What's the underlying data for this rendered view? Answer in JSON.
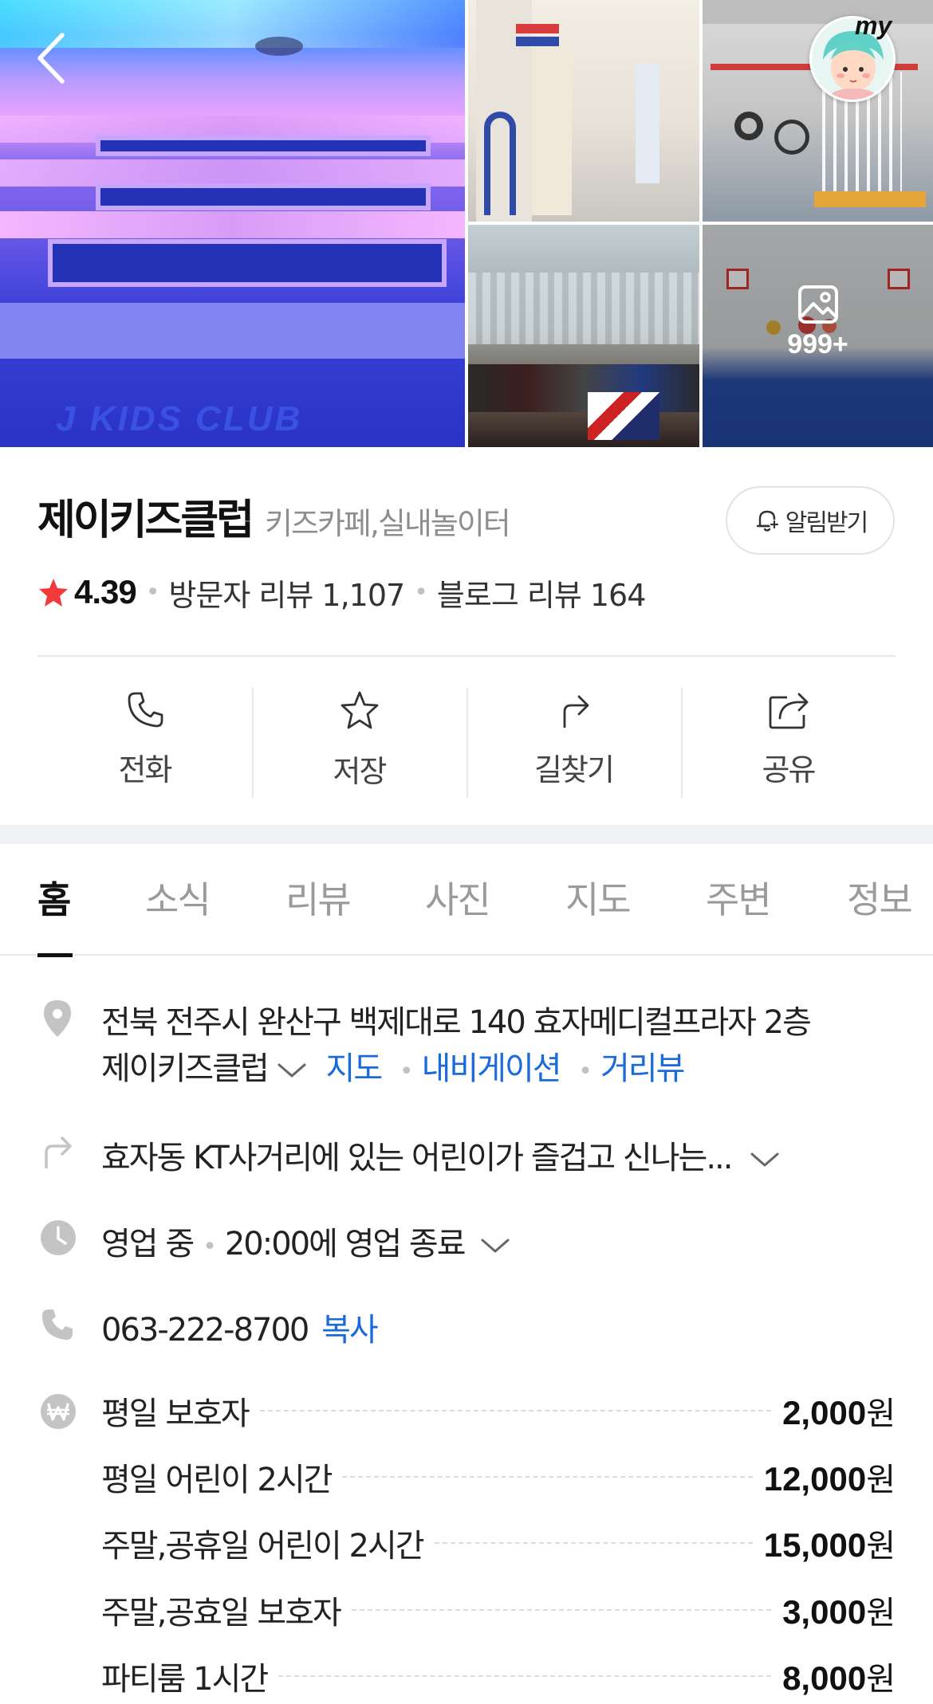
{
  "gallery": {
    "more_count": "999+",
    "main_photo_text": "J KIDS CLUB"
  },
  "nav": {
    "my_label": "my"
  },
  "place": {
    "name": "제이키즈클럽",
    "category": "키즈카페,실내놀이터",
    "alarm_label": "알림받기",
    "rating": "4.39",
    "visitor_reviews": "방문자 리뷰 1,107",
    "blog_reviews": "블로그 리뷰 164",
    "star_color": "#f23a3a"
  },
  "actions": [
    {
      "label": "전화",
      "icon": "phone-icon"
    },
    {
      "label": "저장",
      "icon": "star-icon"
    },
    {
      "label": "길찾기",
      "icon": "directions-icon"
    },
    {
      "label": "공유",
      "icon": "share-icon"
    }
  ],
  "tabs": [
    "홈",
    "소식",
    "리뷰",
    "사진",
    "지도",
    "주변",
    "정보"
  ],
  "info": {
    "address_line1": "전북 전주시 완산구 백제대로 140 효자메디컬프라자 2층",
    "address_line2": "제이키즈클럽",
    "map_link": "지도",
    "navigation_link": "내비게이션",
    "streetview_link": "거리뷰",
    "directions_text": "효자동 KT사거리에 있는 어린이가 즐겁고 신나는...",
    "status": "영업 중",
    "close_time": "20:00에 영업 종료",
    "phone": "063-222-8700",
    "copy_label": "복사",
    "link_color": "#1a6ad9"
  },
  "prices": [
    {
      "name": "평일 보호자",
      "value": "2,000",
      "unit": "원"
    },
    {
      "name": "평일 어린이 2시간",
      "value": "12,000",
      "unit": "원"
    },
    {
      "name": "주말,공휴일 어린이 2시간",
      "value": "15,000",
      "unit": "원"
    },
    {
      "name": "주말,공효일 보호자",
      "value": "3,000",
      "unit": "원"
    },
    {
      "name": "파티룸 1시간",
      "value": "8,000",
      "unit": "원"
    }
  ]
}
